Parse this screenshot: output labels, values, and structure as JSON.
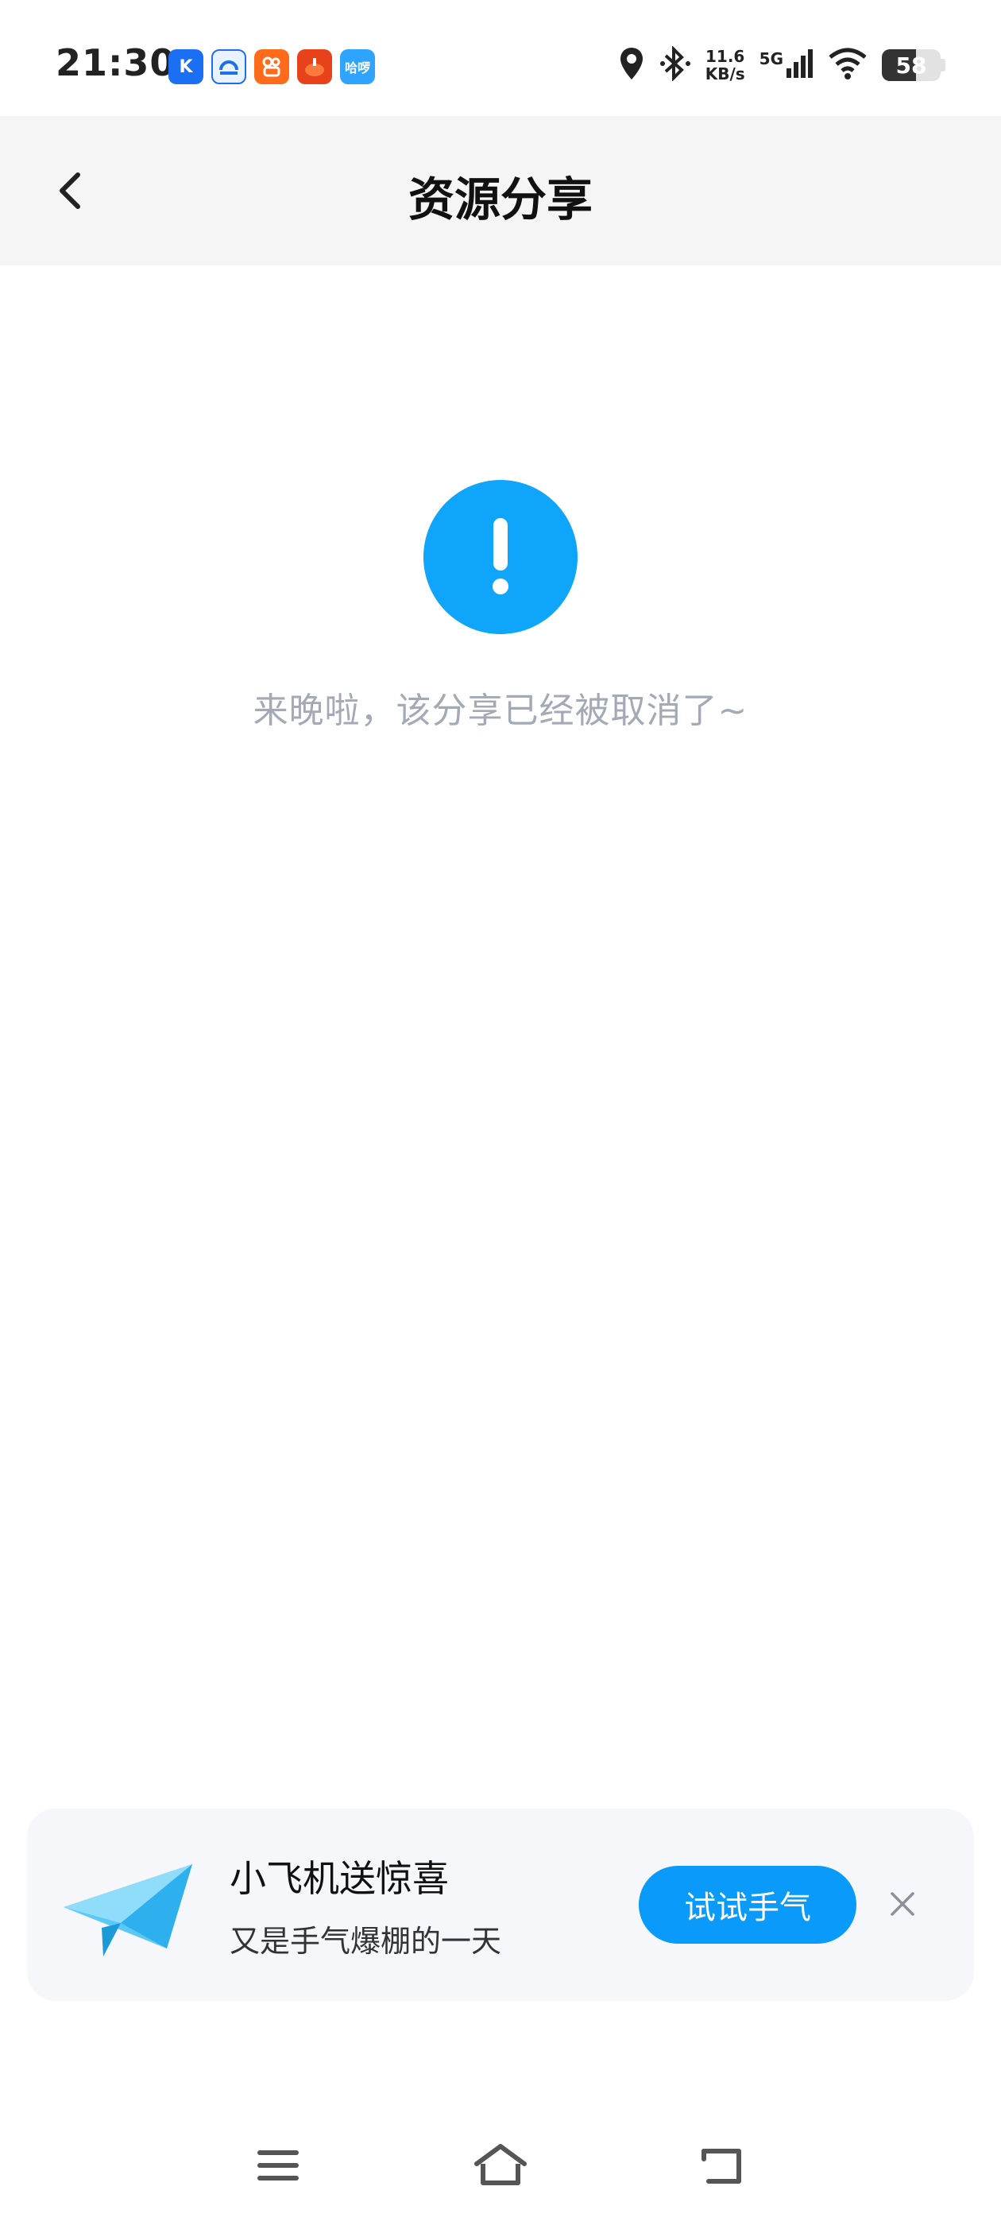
{
  "status_bar": {
    "time": "21:30",
    "net_speed_value": "11.6",
    "net_speed_unit": "KB/s",
    "network_type": "5G",
    "battery": "58",
    "battery_level": 0.58,
    "app_icons": [
      "k-icon",
      "bank-app-icon",
      "kuaishou-icon",
      "red-app-icon",
      "hello-app-icon"
    ],
    "app_icon_text": {
      "k": "K",
      "ha": "哈啰"
    }
  },
  "header": {
    "title": "资源分享"
  },
  "main": {
    "icon": "exclamation-icon",
    "icon_color": "#0ea5fa",
    "message": "来晚啦，该分享已经被取消了~"
  },
  "promo": {
    "title": "小飞机送惊喜",
    "subtitle": "又是手气爆棚的一天",
    "button_label": "试试手气",
    "button_color": "#0a9bfa"
  },
  "nav": {
    "items": [
      "menu-icon",
      "home-icon",
      "back-icon"
    ]
  }
}
